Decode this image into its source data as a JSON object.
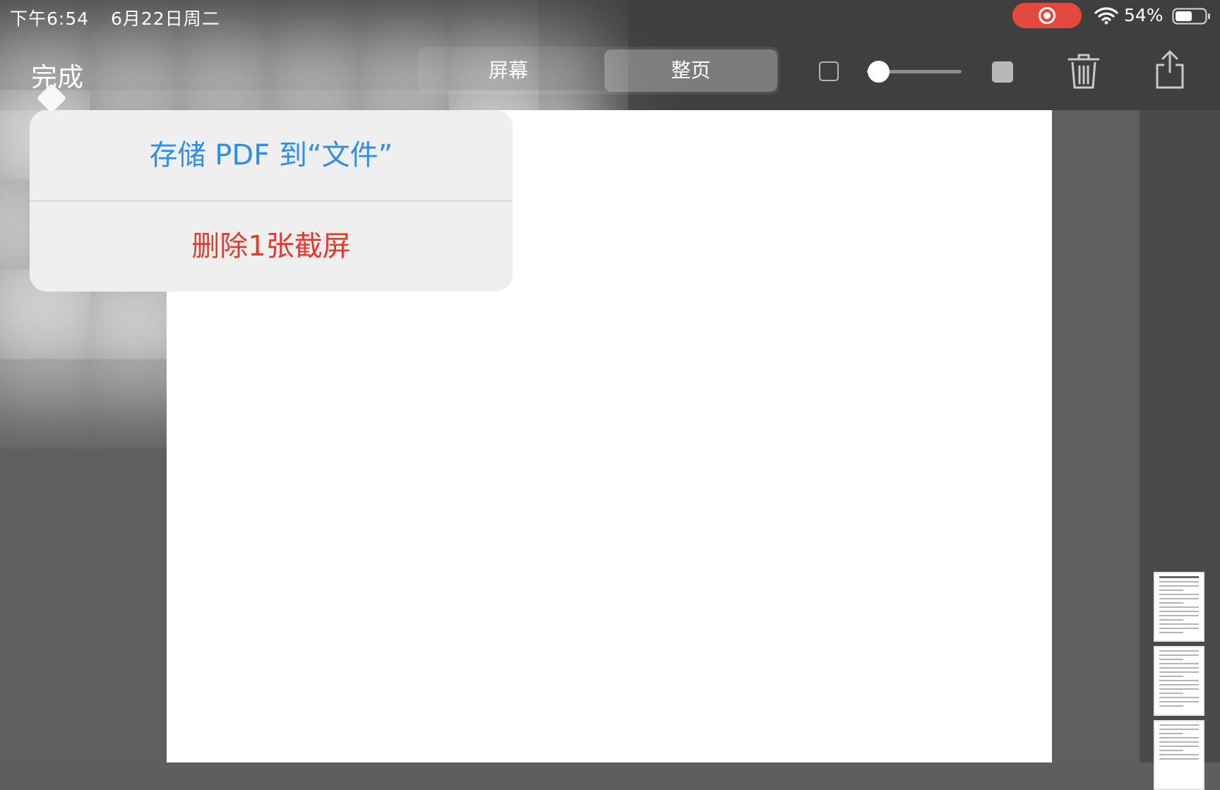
{
  "status_bar": {
    "time": "下午6:54",
    "date": "6月22日周二",
    "battery_percent": "54%",
    "recording_color": "#e5483d"
  },
  "toolbar": {
    "done_label": "完成",
    "segments": [
      "屏幕",
      "整页"
    ],
    "selected_segment": "整页",
    "opacity_slider_value": 0.1
  },
  "popover": {
    "save_pdf_label": "存储 PDF 到“文件”",
    "delete_label": "删除1张截屏",
    "save_color": "#2e8ee8",
    "delete_color": "#e6392f"
  },
  "icons": {
    "recording": "screen-recording-icon",
    "wifi": "wifi-icon",
    "battery": "battery-icon",
    "trash": "trash-icon",
    "share": "share-icon",
    "opacity_low": "opacity-low-icon",
    "opacity_high": "opacity-high-icon"
  },
  "thumbnails": {
    "count_visible": 3
  }
}
